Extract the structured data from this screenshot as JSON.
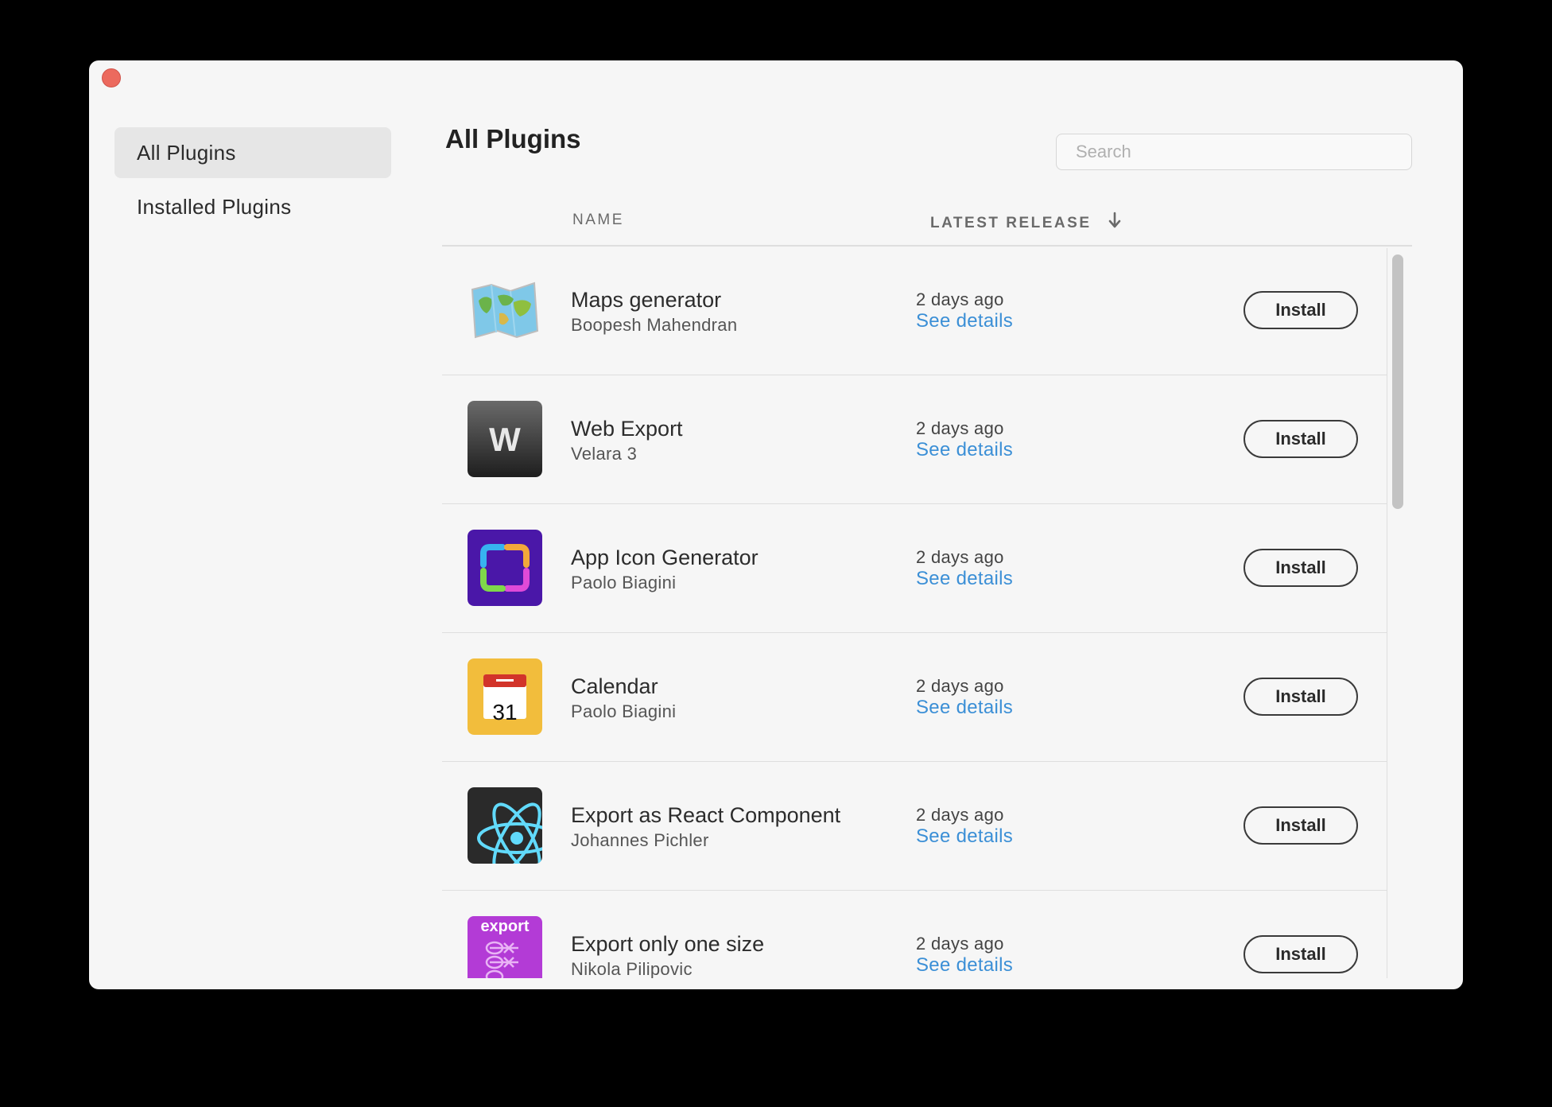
{
  "sidebar": {
    "items": [
      {
        "label": "All Plugins",
        "active": true
      },
      {
        "label": "Installed Plugins",
        "active": false
      }
    ]
  },
  "main": {
    "title": "All Plugins",
    "search": {
      "placeholder": "Search",
      "value": ""
    },
    "columns": {
      "name": "NAME",
      "latest_release": "LATEST RELEASE",
      "sort_icon": "arrow-down-icon"
    }
  },
  "plugins": [
    {
      "name": "Maps generator",
      "author": "Boopesh Mahendran",
      "released": "2 days ago",
      "details": "See details",
      "action": "Install",
      "icon": "folded-map-icon"
    },
    {
      "name": "Web Export",
      "author": "Velara 3",
      "released": "2 days ago",
      "details": "See details",
      "action": "Install",
      "icon": "w-letter-icon"
    },
    {
      "name": "App Icon Generator",
      "author": "Paolo Biagini",
      "released": "2 days ago",
      "details": "See details",
      "action": "Install",
      "icon": "app-frame-icon"
    },
    {
      "name": "Calendar",
      "author": "Paolo Biagini",
      "released": "2 days ago",
      "details": "See details",
      "action": "Install",
      "icon": "calendar-icon",
      "icon_text": "31"
    },
    {
      "name": "Export as React Component",
      "author": "Johannes Pichler",
      "released": "2 days ago",
      "details": "See details",
      "action": "Install",
      "icon": "react-atom-icon"
    },
    {
      "name": "Export only one size",
      "author": "Nikola Pilipovic",
      "released": "2 days ago",
      "details": "See details",
      "action": "Install",
      "icon": "export-sizes-icon",
      "icon_text": "export"
    }
  ],
  "colors": {
    "link": "#3b8fd6",
    "close_button": "#ec6a5e",
    "app_icon_bg": "#4a17a8",
    "calendar_bg": "#f2bd3c",
    "export_bg": "#b33bd6",
    "react_bg": "#2a2a2a",
    "react_atom": "#61dafb"
  }
}
